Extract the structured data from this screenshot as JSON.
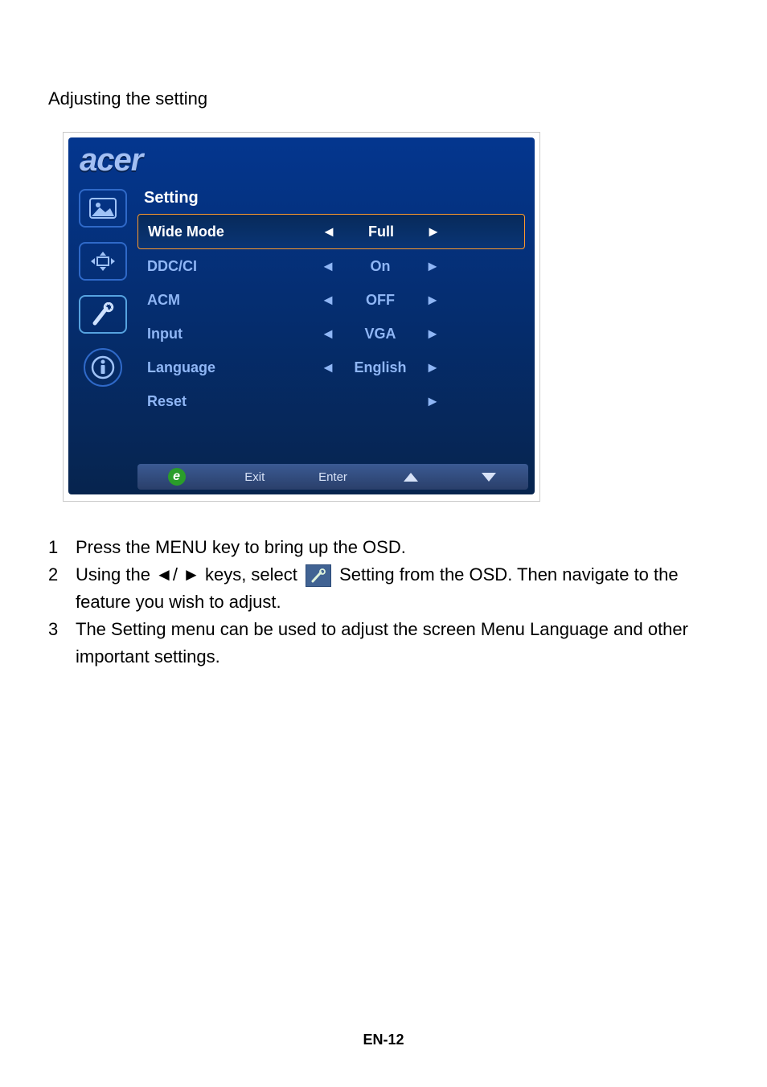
{
  "section_title": "Adjusting the setting",
  "brand": "acer",
  "osd": {
    "panel_title": "Setting",
    "rows": [
      {
        "label": "Wide Mode",
        "value": "Full",
        "has_left": true,
        "has_right": true
      },
      {
        "label": "DDC/CI",
        "value": "On",
        "has_left": true,
        "has_right": true
      },
      {
        "label": "ACM",
        "value": "OFF",
        "has_left": true,
        "has_right": true
      },
      {
        "label": "Input",
        "value": "VGA",
        "has_left": true,
        "has_right": true
      },
      {
        "label": "Language",
        "value": "English",
        "has_left": true,
        "has_right": true
      },
      {
        "label": "Reset",
        "value": "",
        "has_left": false,
        "has_right": true
      }
    ],
    "footer": {
      "e": "e",
      "exit": "Exit",
      "enter": "Enter"
    }
  },
  "instructions": [
    {
      "n": "1",
      "text_before": "Press the MENU key to bring up the OSD."
    },
    {
      "n": "2",
      "text_before": "Using the ",
      "keys": "◄/ ►",
      "text_mid1": " keys, select ",
      "text_mid2": " Setting from the OSD. Then navigate to the feature you wish to adjust."
    },
    {
      "n": "3",
      "text_before": "The Setting menu can be used to adjust the screen Menu Language and other important settings."
    }
  ],
  "page_number": "EN-12"
}
